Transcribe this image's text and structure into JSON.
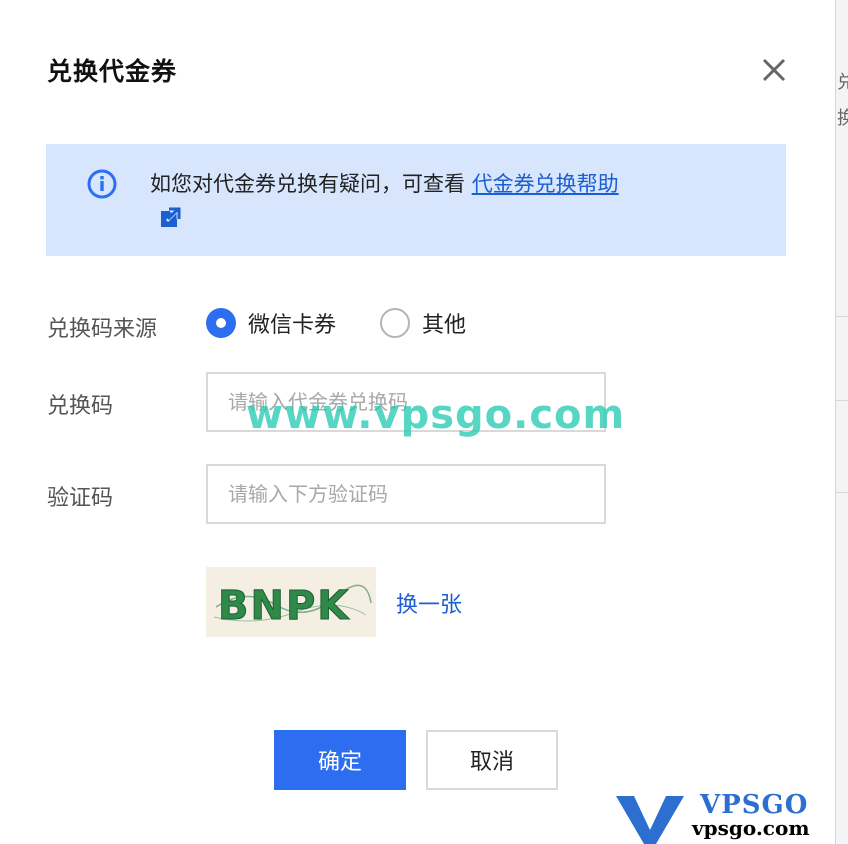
{
  "dialog": {
    "title": "兑换代金券"
  },
  "notice": {
    "text": "如您对代金券兑换有疑问，可查看 ",
    "link": "代金券兑换帮助"
  },
  "form": {
    "source_label": "兑换码来源",
    "source_options": [
      {
        "label": "微信卡券",
        "selected": true
      },
      {
        "label": "其他",
        "selected": false
      }
    ],
    "code_label": "兑换码",
    "code_placeholder": "请输入代金券兑换码",
    "verify_label": "验证码",
    "verify_placeholder": "请输入下方验证码",
    "captcha_text": "BNPK",
    "refresh_label": "换一张"
  },
  "buttons": {
    "confirm": "确定",
    "cancel": "取消"
  },
  "watermark": {
    "text": "www.vpsgo.com",
    "logo_brand": "VPSGO",
    "logo_site": "vpsgo.com"
  },
  "colors": {
    "primary": "#2d6ef0",
    "link": "#1b5fd1",
    "notice_bg": "#d7e6fc"
  }
}
